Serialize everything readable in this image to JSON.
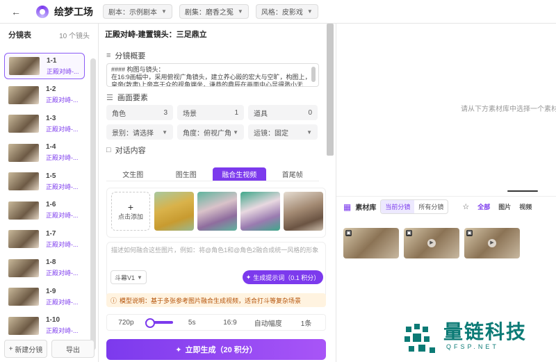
{
  "header": {
    "app_name": "绘梦工场",
    "script_label": "剧本：示例剧本",
    "episode_label": "剧集：磨香之冤",
    "style_label": "风格：皮影戏"
  },
  "sidebar": {
    "title": "分镜表",
    "count": "10 个镜头",
    "items": [
      {
        "no": "1-1",
        "title": "正殿对峙-..."
      },
      {
        "no": "1-2",
        "title": "正殿对峙-..."
      },
      {
        "no": "1-3",
        "title": "正殿对峙-..."
      },
      {
        "no": "1-4",
        "title": "正殿对峙-..."
      },
      {
        "no": "1-5",
        "title": "正殿对峙-..."
      },
      {
        "no": "1-6",
        "title": "正殿对峙-..."
      },
      {
        "no": "1-7",
        "title": "正殿对峙-..."
      },
      {
        "no": "1-8",
        "title": "正殿对峙-..."
      },
      {
        "no": "1-9",
        "title": "正殿对峙-..."
      },
      {
        "no": "1-10",
        "title": "正殿对峙-..."
      }
    ],
    "new_btn": "新建分镜",
    "export_btn": "导出"
  },
  "editor": {
    "title": "正殿对峙-建置镜头：三足鼎立",
    "overview_label": "分镜概要",
    "overview_text": "#### 构图与镜头：\n在16:9画幅中，采用俯视广角镜头，建立养心殿的宏大与空旷，构图上，\n皇帝(敦肃)上帝高于众的视角端坐，谦恭的鼎辰在画面中心显得渺小无",
    "elements_label": "画面要素",
    "role": "角色",
    "role_count": "3",
    "scene": "场景",
    "scene_count": "1",
    "prop": "道具",
    "prop_count": "0",
    "shot_label": "景别：请选择",
    "angle_label": "角度：俯视广角",
    "motion_label": "运镜：固定",
    "dialogue_label": "对话内容",
    "tabs": [
      "文生图",
      "图生图",
      "融合生视频",
      "首尾帧"
    ],
    "add_label": "点击添加",
    "prompt_placeholder": "描述如何融合这些图片，例如：将@角色1和@角色2融合成统一风格的形象",
    "model": "斗幕V1",
    "gen_prompt": "生成提示词（0.1 积分）",
    "note": "模型说明：基于多张参考图片融合生成视频，适合打斗等复杂场景",
    "params": [
      "720p",
      "5s",
      "16:9",
      "自动幅度",
      "1条"
    ],
    "submit": "立即生成（20 积分）"
  },
  "preview": {
    "hint": "请从下方素材库中选择一个素材"
  },
  "library": {
    "title": "素材库",
    "scope_current": "当前分镜",
    "scope_all": "所有分镜",
    "filter_all": "全部",
    "filter_image": "图片",
    "filter_video": "视频"
  },
  "watermark": {
    "text": "量链科技",
    "url": "QFSP.NET"
  },
  "colors": {
    "accent": "#7c3aed",
    "note_bg": "#fff3e0",
    "watermark": "#0b7a75"
  }
}
